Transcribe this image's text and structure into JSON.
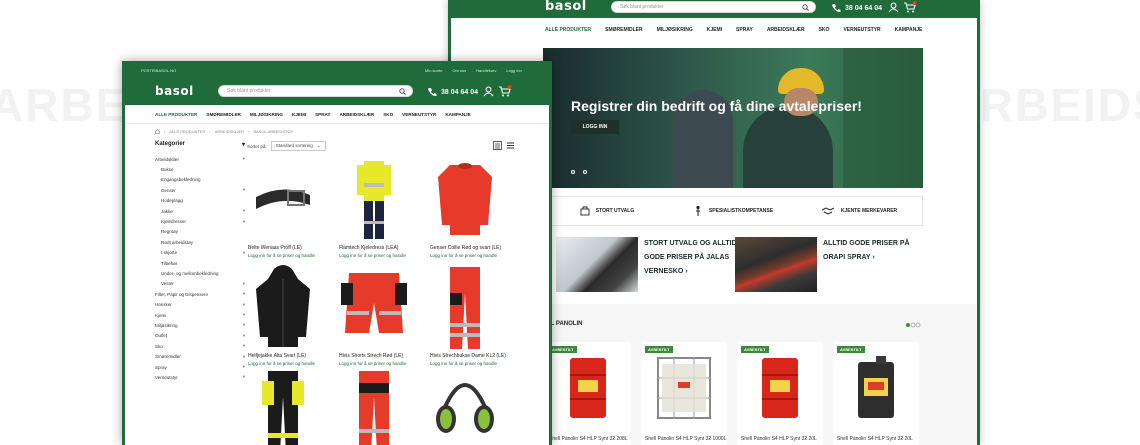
{
  "back": {
    "logo": "basol",
    "search_placeholder": "Søk blant produkter",
    "phone": "38 04 64 04",
    "cart_count": "0",
    "nav": [
      "ALLE PRODUKTER",
      "SMØREMIDLER",
      "MILJØSIKRING",
      "KJEMI",
      "SPRAY",
      "ARBEIDSKLÆR",
      "SKO",
      "VERNEUTSTYR",
      "KAMPANJE"
    ],
    "hero_title": "Registrer din bedrift og få dine avtalepriser!",
    "hero_button": "LOGG INN",
    "usps": [
      "STORT UTVALG",
      "SPESIALISTKOMPETANSE",
      "KJENTE MERKEVARER"
    ],
    "promos": [
      {
        "lines": [
          "STORT UTVALG OG ALLTID",
          "GODE PRISER PÅ JALAS",
          "VERNESKO ›"
        ]
      },
      {
        "lines": [
          "ALLTID GODE PRISER PÅ",
          "ORAPI SPRAY ›"
        ]
      }
    ],
    "section_title": "LL PANOLIN",
    "products": [
      {
        "badge": "AVBESTILT",
        "name": "Shell Panolin S4 HLP Synt 32 208L"
      },
      {
        "badge": "AVBESTILT",
        "name": "Shell Panolin S4 HLP Synt 32 1000L"
      },
      {
        "badge": "AVBESTILT",
        "name": "Shell Panolin S4 HLP Synt 32 20L"
      },
      {
        "badge": "AVBESTILT",
        "name": "Shell Panolin S4 HLP Synt 32 20L"
      }
    ]
  },
  "front": {
    "top_left": "POSTEIBASOL.NO",
    "top_links": [
      "Min konto",
      "Om oss",
      "Handlekurv",
      "Logg inn"
    ],
    "logo": "basol",
    "search_placeholder": "Søk blant produkter",
    "phone": "38 04 64 04",
    "cart_count": "0",
    "nav": [
      "ALLE PRODUKTER",
      "SMØREMIDLER",
      "MILJØSIKRING",
      "KJEMI",
      "SPRAY",
      "ARBEIDSKLÆR",
      "SKO",
      "VERNEUTSTYR",
      "KAMPANJE"
    ],
    "breadcrumb": [
      "ALLE PRODUKTER",
      "ARBEIDSKLÆR",
      "BASOL ARBEIDSTØY"
    ],
    "sort_label": "Sorter på:",
    "sort_value": "Standard sortering",
    "categories_title": "Kategorier",
    "categories": [
      {
        "label": "Arbeidsklær",
        "sub": false,
        "chev": true
      },
      {
        "label": "Bukse",
        "sub": true,
        "chev": false
      },
      {
        "label": "Engangsbekledning",
        "sub": true,
        "chev": false
      },
      {
        "label": "Genser",
        "sub": true,
        "chev": true
      },
      {
        "label": "Hodeplagg",
        "sub": true,
        "chev": false
      },
      {
        "label": "Jakke",
        "sub": true,
        "chev": true
      },
      {
        "label": "Kjeledresser",
        "sub": true,
        "chev": true
      },
      {
        "label": "Regntøy",
        "sub": true,
        "chev": false
      },
      {
        "label": "Rødt arbeidstøy",
        "sub": true,
        "chev": false
      },
      {
        "label": "t-skjorte",
        "sub": true,
        "chev": true
      },
      {
        "label": "Tilbehør",
        "sub": true,
        "chev": false
      },
      {
        "label": "Under- og mellombekledning",
        "sub": true,
        "chev": false
      },
      {
        "label": "Vester",
        "sub": true,
        "chev": true
      },
      {
        "label": "Filter, Papir og Dispensere",
        "sub": false,
        "chev": true
      },
      {
        "label": "Hansker",
        "sub": false,
        "chev": true
      },
      {
        "label": "Kjemi",
        "sub": false,
        "chev": true
      },
      {
        "label": "Miljøsikring",
        "sub": false,
        "chev": true
      },
      {
        "label": "Outlet",
        "sub": false,
        "chev": true
      },
      {
        "label": "Sko",
        "sub": false,
        "chev": true
      },
      {
        "label": "Smøremidler",
        "sub": false,
        "chev": true
      },
      {
        "label": "Spray",
        "sub": false,
        "chev": true
      },
      {
        "label": "Verneutstyr",
        "sub": false,
        "chev": true
      }
    ],
    "products": [
      {
        "name": "Belte Wenaas Proff (LE)",
        "link": "Logg inn for å se priser og handle",
        "kind": "belt"
      },
      {
        "name": "Flamtech Kjeledress (LEA)",
        "link": "Logg inn for å se priser og handle",
        "kind": "overall"
      },
      {
        "name": "Genser Collie Rød og svart (LE)",
        "link": "Logg inn for å se priser og handle",
        "kind": "sweater"
      },
      {
        "name": "Helfjejakke Alta Svart (LE)",
        "link": "Logg inn for å se priser og handle",
        "kind": "hoodie"
      },
      {
        "name": "Hivis Shorts Strech Rød (LE)",
        "link": "Logg inn for å se priser og handle",
        "kind": "shorts"
      },
      {
        "name": "Hivis Strechbukse Dame KL2 (LE)",
        "link": "Logg inn for å se priser og handle",
        "kind": "pants"
      },
      {
        "name": "",
        "link": "",
        "kind": "pants_black"
      },
      {
        "name": "",
        "link": "",
        "kind": "pants_red"
      },
      {
        "name": "",
        "link": "",
        "kind": "earmuff"
      }
    ]
  },
  "colors": {
    "brand": "#1f6b3a",
    "accent_red": "#e03a2a",
    "hivis_yellow": "#e8e82a"
  }
}
